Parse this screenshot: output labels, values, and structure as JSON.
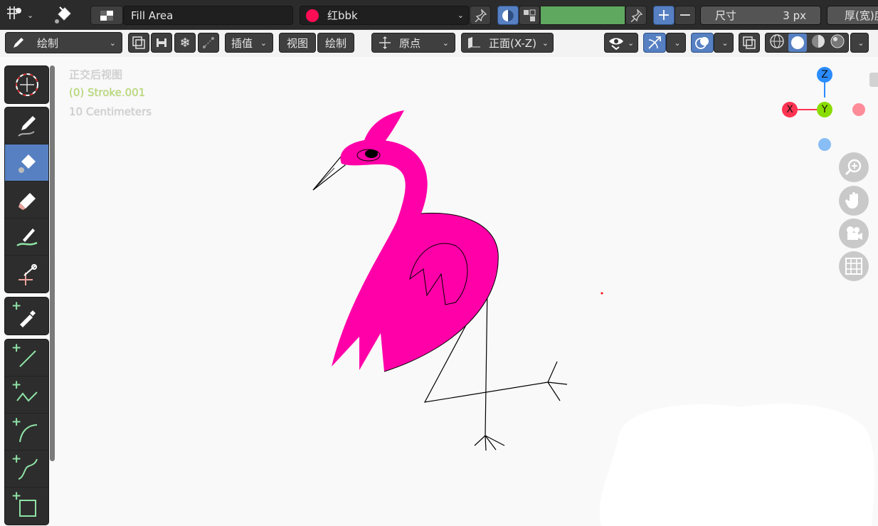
{
  "header": {
    "fill_mode_label": "Fill Area",
    "material_name": "红bbk",
    "material_color": "#ff0d55",
    "strength_color": "#5fa85f",
    "size_label": "尺寸",
    "size_value": "3 px",
    "thickness_label": "厚(宽)度"
  },
  "toolbar2": {
    "mode": "绘制",
    "interpolate": "插值",
    "view": "视图",
    "draw": "绘制",
    "origin": "原点",
    "projection": "正面(X-Z)"
  },
  "viewport": {
    "view_name": "正交后视图",
    "object_name": "(0) Stroke.001",
    "scale": "10 Centimeters"
  },
  "gizmo": {
    "x": "X",
    "y": "Y",
    "z": "Z"
  },
  "colors": {
    "accent": "#5680c2",
    "flamingo": "#ff00a8",
    "background": "#f9f9f9"
  }
}
